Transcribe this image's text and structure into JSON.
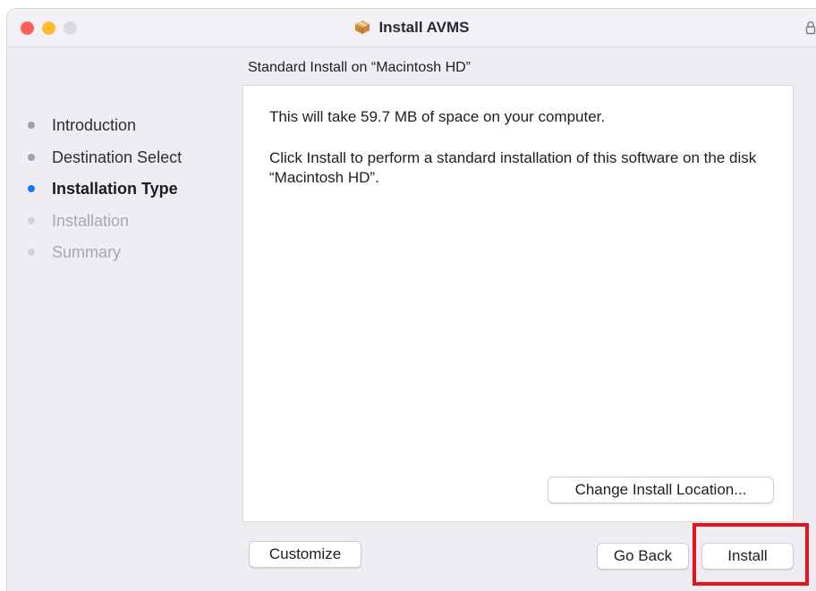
{
  "window": {
    "title": "Install AVMS",
    "title_icon": "package-icon",
    "controls": [
      "close",
      "minimize",
      "zoom"
    ],
    "lock_icon": "lock-icon"
  },
  "subtitle": "Standard Install on “Macintosh HD”",
  "sidebar": {
    "steps": [
      {
        "label": "Introduction",
        "state": "done"
      },
      {
        "label": "Destination Select",
        "state": "done"
      },
      {
        "label": "Installation Type",
        "state": "current"
      },
      {
        "label": "Installation",
        "state": "future"
      },
      {
        "label": "Summary",
        "state": "future"
      }
    ]
  },
  "content": {
    "space_text": "This will take 59.7 MB of space on your computer.",
    "install_text": "Click Install to perform a standard installation of this software on the disk “Macintosh HD”.",
    "change_location_label": "Change Install Location..."
  },
  "footer": {
    "customize_label": "Customize",
    "go_back_label": "Go Back",
    "install_label": "Install"
  },
  "colors": {
    "current_step": "#0a7bff",
    "highlight_box": "#e3141b",
    "close": "#fe5f57",
    "minimize": "#febc2e"
  }
}
